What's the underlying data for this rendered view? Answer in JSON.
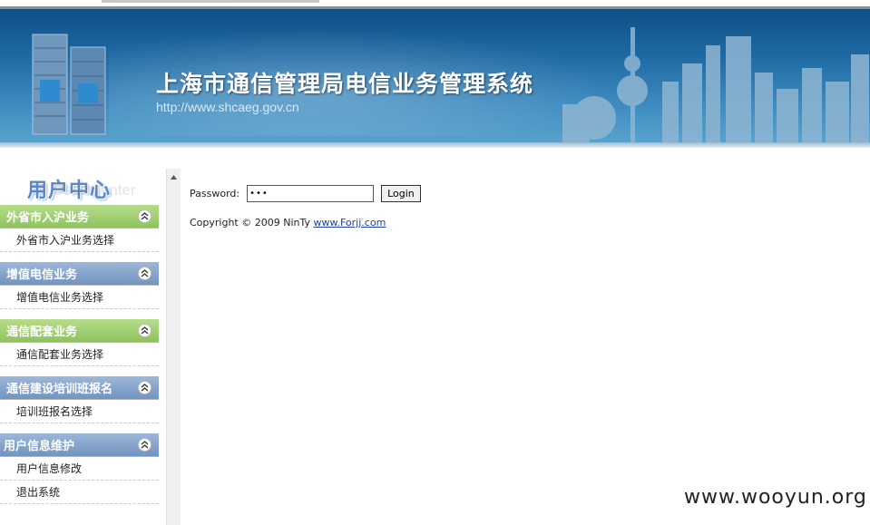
{
  "banner": {
    "title": "上海市通信管理局电信业务管理系统",
    "url": "http://www.shcaeg.gov.cn"
  },
  "sidebar": {
    "header_main": "用户中心",
    "header_ghost": "User Center",
    "sections": [
      {
        "title": "外省市入沪业务",
        "color": "green",
        "items": [
          "外省市入沪业务选择"
        ]
      },
      {
        "title": "增值电信业务",
        "color": "blue",
        "items": [
          "增值电信业务选择"
        ]
      },
      {
        "title": "通信配套业务",
        "color": "green",
        "items": [
          "通信配套业务选择"
        ]
      },
      {
        "title": "通信建设培训班报名",
        "color": "blue",
        "items": [
          "培训班报名选择"
        ]
      },
      {
        "title": "用户信息维护",
        "color": "blue",
        "items": [
          "用户信息修改",
          "退出系统"
        ]
      }
    ]
  },
  "login": {
    "password_label": "Password:",
    "password_value": "•••",
    "login_button": "Login"
  },
  "footer": {
    "copyright_text": "Copyright © 2009 NinTy ",
    "link_text": "www.Forjj.com"
  },
  "watermark": "www.wooyun.org",
  "colors": {
    "banner": "#1f6aa4",
    "section_green": "#8fc35e",
    "section_blue": "#7194c0",
    "link": "#1a3fa8"
  }
}
